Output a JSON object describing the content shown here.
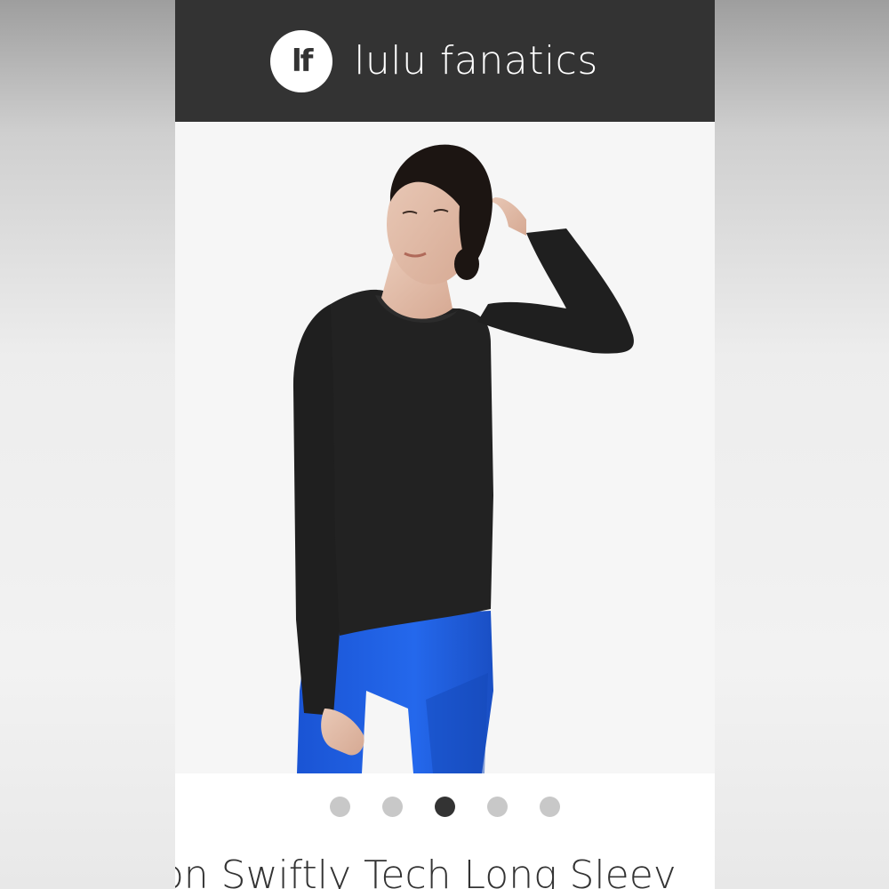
{
  "header": {
    "logo_text": "lf",
    "brand_name": "lulu fanatics",
    "background_color": "#333333"
  },
  "product": {
    "title": "mon Swiftly Tech Long Sleev",
    "image_description_icon": "product-photo"
  },
  "carousel": {
    "dot_count": 5,
    "active_index": 2
  },
  "colors": {
    "shirt": "#1e1e1e",
    "leggings": "#1d5fe0",
    "header": "#333333",
    "dot_inactive": "#c8c8c8",
    "dot_active": "#333333"
  }
}
